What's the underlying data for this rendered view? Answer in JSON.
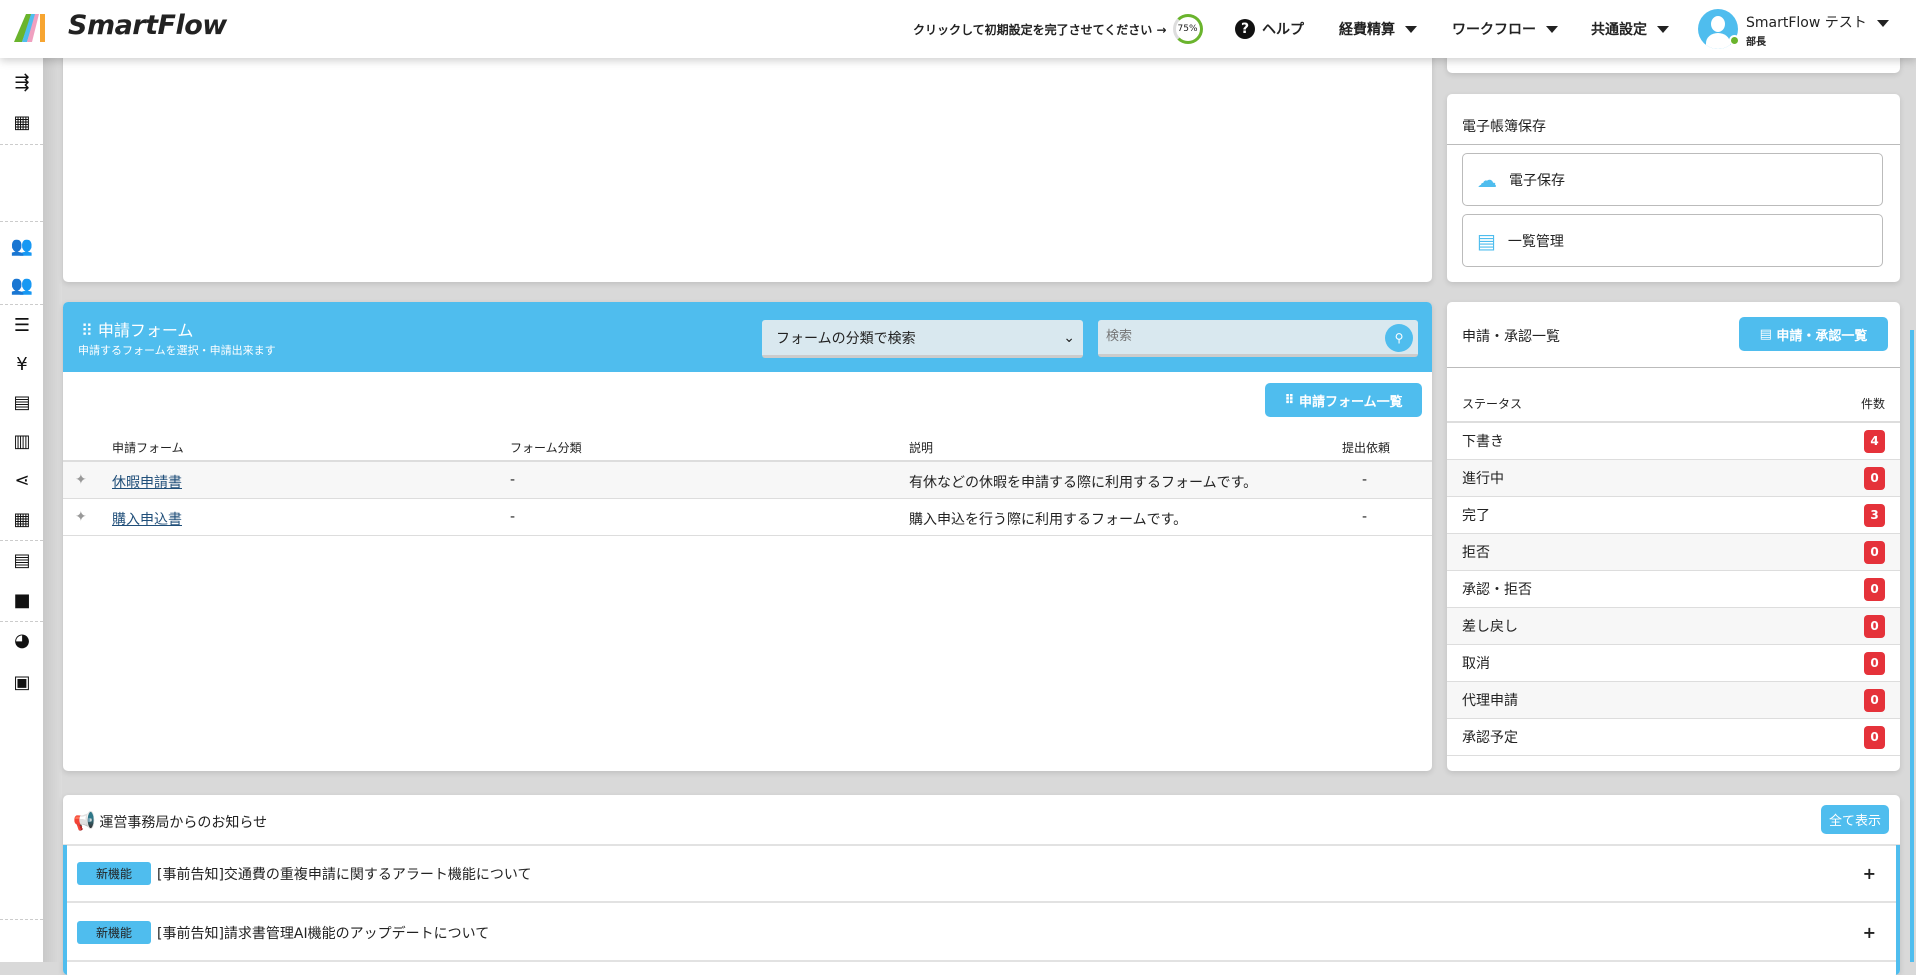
{
  "header": {
    "brand": "SmartFlow",
    "setup_prompt": "クリックして初期設定を完了させてください →",
    "setup_progress_percent": 75,
    "setup_progress_label": "75%",
    "help": "ヘルプ",
    "menus": [
      "経費精算",
      "ワークフロー",
      "共通設定"
    ],
    "user_name": "SmartFlow テスト",
    "user_role": "部長",
    "status_color": "#6ab42d"
  },
  "sidebar": {
    "icons": [
      "collapse-menu-icon",
      "company-icon",
      "users-icon",
      "groups-icon",
      "list-icon",
      "yen-icon",
      "receipt-icon",
      "invoice-icon",
      "share-icon",
      "table-icon",
      "documents-icon",
      "file-icon",
      "palette-icon",
      "wallet-icon"
    ]
  },
  "ebook": {
    "title": "電子帳簿保存",
    "items": [
      {
        "label": "電子保存",
        "icon": "cloud-upload-icon"
      },
      {
        "label": "一覧管理",
        "icon": "list-doc-icon"
      }
    ]
  },
  "forms": {
    "title": "申請フォーム",
    "subtitle": "申請するフォームを選択・申請出来ます",
    "category_select": "フォームの分類で検索",
    "search_placeholder": "検索",
    "list_button": "申請フォーム一覧",
    "columns": [
      "申請フォーム",
      "フォーム分類",
      "説明",
      "提出依頼"
    ],
    "rows": [
      {
        "name": "休暇申請書",
        "category": "-",
        "description": "有休などの休暇を申請する際に利用するフォームです。",
        "request": "-"
      },
      {
        "name": "購入申込書",
        "category": "-",
        "description": "購入申込を行う際に利用するフォームです。",
        "request": "-"
      }
    ]
  },
  "approvals": {
    "title": "申請・承認一覧",
    "button": "申請・承認一覧",
    "col_status": "ステータス",
    "col_count": "件数",
    "rows": [
      {
        "label": "下書き",
        "count": "4"
      },
      {
        "label": "進行中",
        "count": "0"
      },
      {
        "label": "完了",
        "count": "3"
      },
      {
        "label": "拒否",
        "count": "0"
      },
      {
        "label": "承認・拒否",
        "count": "0"
      },
      {
        "label": "差し戻し",
        "count": "0"
      },
      {
        "label": "取消",
        "count": "0"
      },
      {
        "label": "代理申請",
        "count": "0"
      },
      {
        "label": "承認予定",
        "count": "0"
      }
    ]
  },
  "notices": {
    "title": "運営事務局からのお知らせ",
    "show_all": "全て表示",
    "items": [
      {
        "tag": "新機能",
        "text": "[事前告知]交通費の重複申請に関するアラート機能について"
      },
      {
        "tag": "新機能",
        "text": "[事前告知]請求書管理AI機能のアップデートについて"
      }
    ]
  },
  "colors": {
    "accent": "#4fbdee",
    "badge": "#e5323a"
  }
}
